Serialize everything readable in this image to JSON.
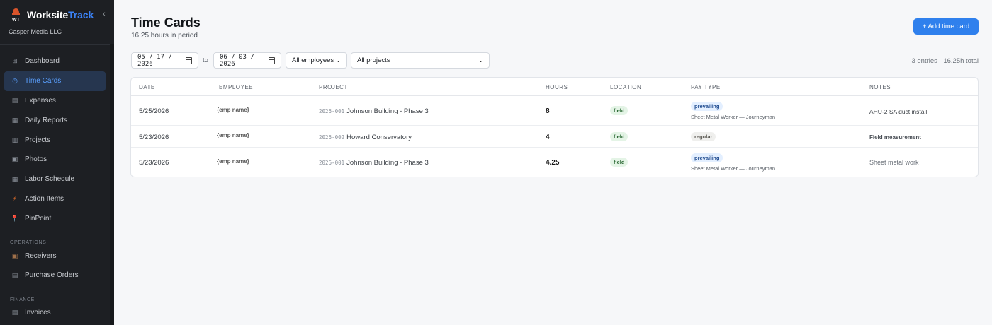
{
  "brand": {
    "name_prefix": "Worksite",
    "name_suffix": "Track",
    "logo_text": "WT",
    "company": "Casper Media LLC",
    "accent_color": "#3b82f6"
  },
  "sidebar": {
    "collapse_glyph": "‹",
    "items": [
      {
        "label": "Dashboard",
        "icon": "grid-icon",
        "glyph": "⊞",
        "active": false
      },
      {
        "label": "Time Cards",
        "icon": "clock-icon",
        "glyph": "◷",
        "active": true
      },
      {
        "label": "Expenses",
        "icon": "receipt-icon",
        "glyph": "▤",
        "active": false
      },
      {
        "label": "Daily Reports",
        "icon": "report-icon",
        "glyph": "▦",
        "active": false
      },
      {
        "label": "Projects",
        "icon": "folder-icon",
        "glyph": "▥",
        "active": false
      },
      {
        "label": "Photos",
        "icon": "camera-icon",
        "glyph": "▣",
        "active": false
      },
      {
        "label": "Labor Schedule",
        "icon": "calendar-icon",
        "glyph": "▦",
        "active": false
      },
      {
        "label": "Action Items",
        "icon": "lightning-icon",
        "glyph": "⚡",
        "active": false
      },
      {
        "label": "PinPoint",
        "icon": "pin-icon",
        "glyph": "📍",
        "active": false
      }
    ],
    "operations_title": "OPERATIONS",
    "operations": [
      {
        "label": "Receivers",
        "icon": "box-icon",
        "glyph": "▣"
      },
      {
        "label": "Purchase Orders",
        "icon": "clipboard-icon",
        "glyph": "▤"
      }
    ],
    "finance_title": "FINANCE",
    "finance": [
      {
        "label": "Invoices",
        "icon": "document-icon",
        "glyph": "▤"
      }
    ]
  },
  "header": {
    "title": "Time Cards",
    "subtitle": "16.25 hours in period",
    "add_button": "+ Add time card"
  },
  "filters": {
    "start_date": "05 / 17 / 2026",
    "to_label": "to",
    "end_date": "06 / 03 / 2026",
    "employee_select": "All employees",
    "project_select": "All projects",
    "summary": "3 entries · 16.25h total"
  },
  "table": {
    "columns": [
      "DATE",
      "EMPLOYEE",
      "PROJECT",
      "HOURS",
      "LOCATION",
      "PAY TYPE",
      "NOTES"
    ],
    "rows": [
      {
        "date": "5/25/2026",
        "employee": "{emp name}",
        "project_code": "2026-001",
        "project_name": "Johnson Building - Phase 3",
        "hours": "8",
        "location": "field",
        "pay_type": "prevailing",
        "pay_detail": "Sheet Metal Worker — Journeyman",
        "notes": "AHU-2 SA duct install"
      },
      {
        "date": "5/23/2026",
        "employee": "{emp name}",
        "project_code": "2026-002",
        "project_name": "Howard Conservatory",
        "hours": "4",
        "location": "field",
        "pay_type": "regular",
        "pay_detail": "",
        "notes": "Field measurement"
      },
      {
        "date": "5/23/2026",
        "employee": "{emp name}",
        "project_code": "2026-001",
        "project_name": "Johnson Building - Phase 3",
        "hours": "4.25",
        "location": "field",
        "pay_type": "prevailing",
        "pay_detail": "Sheet Metal Worker — Journeyman",
        "notes": "Sheet metal work"
      }
    ]
  }
}
